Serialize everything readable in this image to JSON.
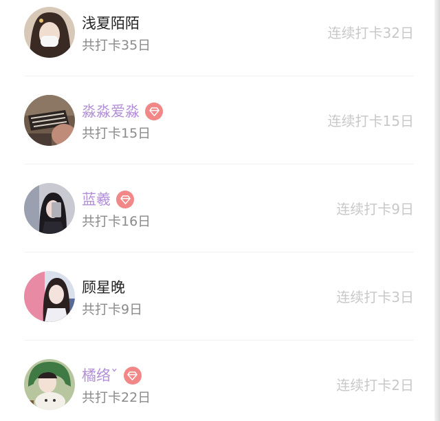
{
  "members": [
    {
      "name": "浅夏陌陌",
      "vip": false,
      "total": "共打卡35日",
      "streak": "连续打卡32日"
    },
    {
      "name": "淼淼爱淼",
      "vip": true,
      "total": "共打卡15日",
      "streak": "连续打卡15日"
    },
    {
      "name": "蓝羲",
      "vip": true,
      "total": "共打卡16日",
      "streak": "连续打卡9日"
    },
    {
      "name": "顾星晚",
      "vip": false,
      "total": "共打卡9日",
      "streak": "连续打卡3日"
    },
    {
      "name": "橘络ˇ",
      "vip": true,
      "total": "共打卡22日",
      "streak": "连续打卡2日"
    }
  ],
  "colors": {
    "vip_name": "#b28fd8",
    "vip_badge": "#f28787",
    "name": "#222222",
    "total": "#8a8a8a",
    "streak": "#c8c8c8"
  },
  "icons": {
    "vip_badge": "diamond-icon"
  }
}
